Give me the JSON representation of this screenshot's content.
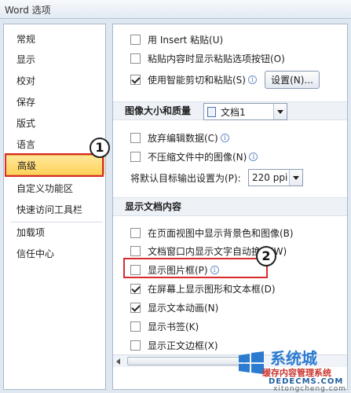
{
  "window": {
    "title": "Word 选项"
  },
  "nav": {
    "items": [
      {
        "label": "常规"
      },
      {
        "label": "显示"
      },
      {
        "label": "校对"
      },
      {
        "label": "保存"
      },
      {
        "label": "版式"
      },
      {
        "label": "语言"
      },
      {
        "label": "高级",
        "selected": true
      },
      {
        "label": "自定义功能区"
      },
      {
        "label": "快速访问工具栏"
      },
      {
        "label": "加载项"
      },
      {
        "label": "信任中心"
      }
    ]
  },
  "paste_options": {
    "insert_paste": {
      "label": "用 Insert 粘贴(U)",
      "checked": false
    },
    "show_paste_button": {
      "label": "粘贴内容时显示粘贴选项按钮(O)",
      "checked": false
    },
    "smart_cut": {
      "label": "使用智能剪切和粘贴(S)",
      "checked": true
    },
    "settings_button": "设置(N)..."
  },
  "image_size_quality": {
    "header": "图像大小和质量",
    "doc_select": "文档1",
    "discard_edit_data": {
      "label": "放弃编辑数据(C)",
      "checked": false
    },
    "no_compress": {
      "label": "不压缩文件中的图像(N)",
      "checked": false
    },
    "default_target_label": "将默认目标输出设置为(P):",
    "default_target_value": "220 ppi"
  },
  "show_document_content": {
    "header": "显示文档内容",
    "options": [
      {
        "label": "在页面视图中显示背景色和图像(B)",
        "checked": false
      },
      {
        "label": "文档窗口内显示文字自动换行(W)",
        "checked": false
      },
      {
        "label": "显示图片框(P)",
        "checked": false
      },
      {
        "label": "在屏幕上显示图形和文本框(D)",
        "checked": true
      },
      {
        "label": "显示文本动画(N)",
        "checked": true
      },
      {
        "label": "显示书签(K)",
        "checked": false
      },
      {
        "label": "显示正文边框(X)",
        "checked": false
      }
    ]
  },
  "annotations": {
    "marker1": "1",
    "marker2": "2"
  },
  "watermark": {
    "line1": "系统城",
    "line2": "缓存内容管理系统",
    "url": "DEDECMS.COM",
    "url2": "xitongcheng.com"
  },
  "colors": {
    "selected_bg": "#ffd25a",
    "highlight_red": "#d92b2b"
  }
}
